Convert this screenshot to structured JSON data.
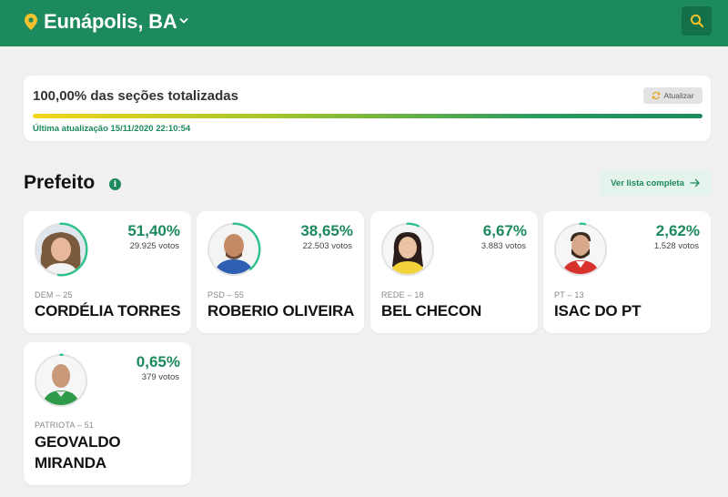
{
  "header": {
    "city": "Eunápolis, BA",
    "pin_icon": "location-pin-icon",
    "chevron_icon": "chevron-down-icon",
    "search_icon": "search-icon"
  },
  "status": {
    "text": "100,00% das seções totalizadas",
    "refresh_label": "Atualizar",
    "progress": 1.0,
    "updated": "Última atualização 15/11/2020 22:10:54"
  },
  "section": {
    "title": "Prefeito",
    "list_label": "Ver lista completa"
  },
  "colors": {
    "accent": "#1c8a5d",
    "ring": "#2fc28a",
    "ring_track": "#e2e2e2"
  },
  "candidates": [
    {
      "pct_label": "51,40%",
      "share": 0.514,
      "votes": "29.925 votos",
      "party": "DEM – 25",
      "name": "CORDÉLIA TORRES",
      "photo": "woman-curly-hair"
    },
    {
      "pct_label": "38,65%",
      "share": 0.3865,
      "votes": "22.503 votos",
      "party": "PSD – 55",
      "name": "ROBERIO OLIVEIRA",
      "photo": "bald-man-blue-shirt"
    },
    {
      "pct_label": "6,67%",
      "share": 0.0667,
      "votes": "3.883 votos",
      "party": "REDE – 18",
      "name": "BEL CHECON",
      "photo": "woman-dark-hair"
    },
    {
      "pct_label": "2,62%",
      "share": 0.0262,
      "votes": "1.528 votos",
      "party": "PT – 13",
      "name": "ISAC DO PT",
      "photo": "bearded-man-red-shirt"
    },
    {
      "pct_label": "0,65%",
      "share": 0.0065,
      "votes": "379 votos",
      "party": "PATRIOTA – 51",
      "name": "GEOVALDO MIRANDA",
      "photo": "bald-man-green-shirt"
    }
  ]
}
